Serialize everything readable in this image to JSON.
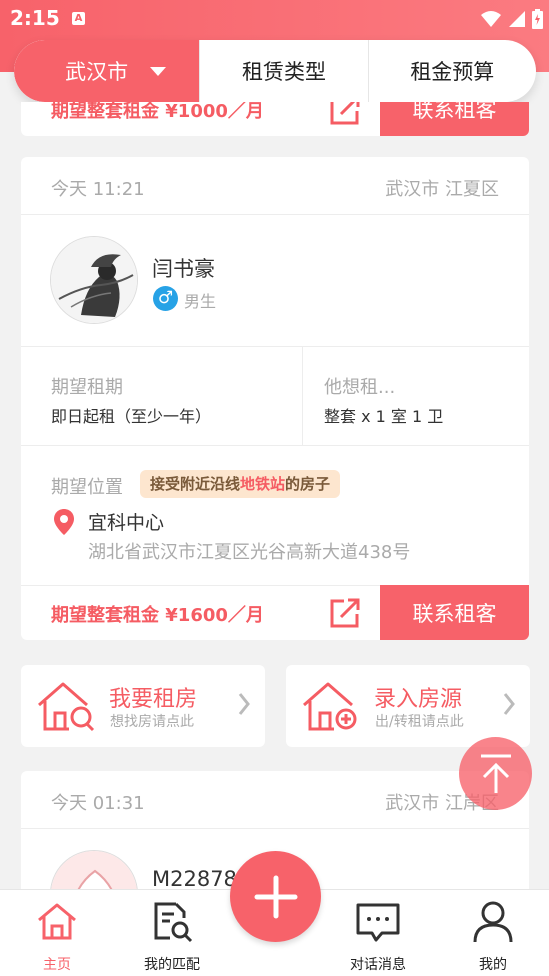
{
  "status": {
    "time": "2:15",
    "indicator": "A"
  },
  "filter": {
    "city": "武汉市",
    "rent_type": "租赁类型",
    "budget": "租金预算"
  },
  "card_top": {
    "price": "期望整套租金 ¥1000／月",
    "contact": "联系租客"
  },
  "card_main": {
    "time": "今天 11:21",
    "location": "武汉市 江夏区",
    "user": {
      "name": "闫书豪",
      "gender_symbol": "♂",
      "gender": "男生"
    },
    "term_label": "期望租期",
    "term_value": "即日起租（至少一年）",
    "want_label": "他想租...",
    "want_value": "整套 x 1 室 1 卫",
    "pos_label": "期望位置",
    "tag": {
      "pre": "接受附近沿线",
      "hl": "地铁站",
      "post": "的房子"
    },
    "place": "宜科中心",
    "address": "湖北省武汉市江夏区光谷高新大道438号",
    "price": "期望整套租金 ¥1600／月",
    "contact": "联系租客"
  },
  "quick": [
    {
      "title": "我要租房",
      "sub": "想找房请点此"
    },
    {
      "title": "录入房源",
      "sub": "出/转租请点此"
    }
  ],
  "card_bottom": {
    "time": "今天 01:31",
    "location": "武汉市 江岸区",
    "user_name": "M22878"
  },
  "tabs": [
    {
      "label": "主页"
    },
    {
      "label": "我的匹配"
    },
    {
      "label": "对话消息"
    },
    {
      "label": "我的"
    }
  ],
  "colors": {
    "accent": "#f7626a",
    "active_tab": "#f7626a",
    "tag_bg": "#fde6cf",
    "male": "#27a2e6"
  }
}
